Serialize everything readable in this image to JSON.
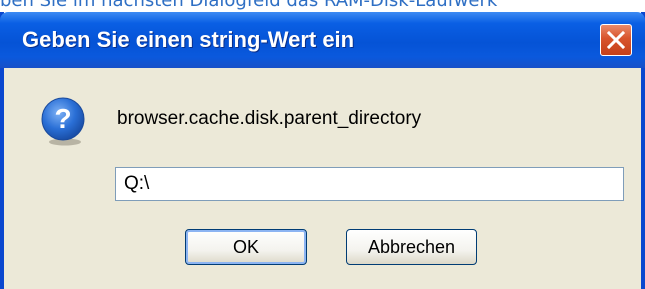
{
  "background_text": "ben Sie im nächsten Dialogfeld das RAM-Disk-Laufwerk",
  "dialog": {
    "title": "Geben Sie einen string-Wert ein",
    "close_icon": "close-icon",
    "question_icon": "question-icon",
    "message": "browser.cache.disk.parent_directory",
    "input_value": "Q:\\",
    "ok_label": "OK",
    "cancel_label": "Abbrechen"
  },
  "colors": {
    "titlebar": "#0553d6",
    "window_border": "#0a47cf",
    "client_bg": "#ece9d8",
    "close_button": "#d8542c",
    "question_icon": "#2a6fd6",
    "background_text": "#2f6fc4"
  }
}
